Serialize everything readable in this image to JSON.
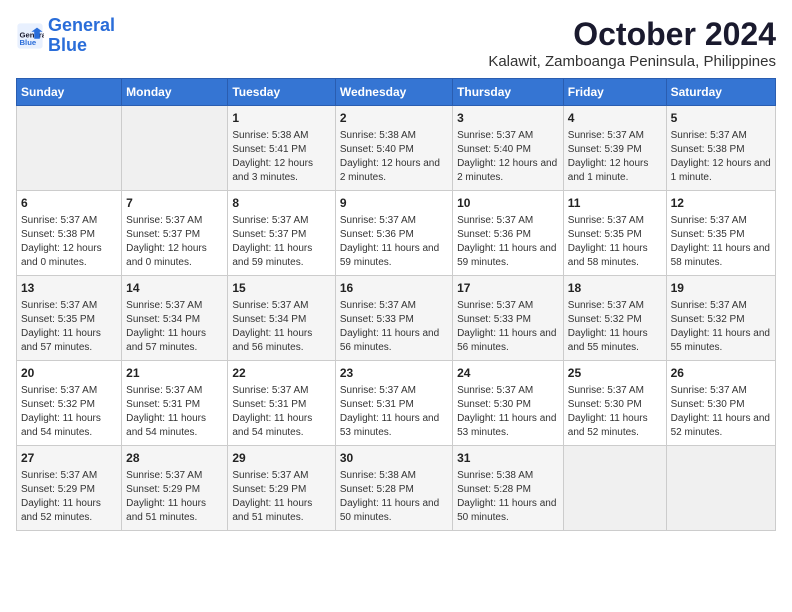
{
  "logo": {
    "text_general": "General",
    "text_blue": "Blue"
  },
  "title": "October 2024",
  "subtitle": "Kalawit, Zamboanga Peninsula, Philippines",
  "days_of_week": [
    "Sunday",
    "Monday",
    "Tuesday",
    "Wednesday",
    "Thursday",
    "Friday",
    "Saturday"
  ],
  "weeks": [
    [
      {
        "day": "",
        "info": ""
      },
      {
        "day": "",
        "info": ""
      },
      {
        "day": "1",
        "info": "Sunrise: 5:38 AM\nSunset: 5:41 PM\nDaylight: 12 hours and 3 minutes."
      },
      {
        "day": "2",
        "info": "Sunrise: 5:38 AM\nSunset: 5:40 PM\nDaylight: 12 hours and 2 minutes."
      },
      {
        "day": "3",
        "info": "Sunrise: 5:37 AM\nSunset: 5:40 PM\nDaylight: 12 hours and 2 minutes."
      },
      {
        "day": "4",
        "info": "Sunrise: 5:37 AM\nSunset: 5:39 PM\nDaylight: 12 hours and 1 minute."
      },
      {
        "day": "5",
        "info": "Sunrise: 5:37 AM\nSunset: 5:38 PM\nDaylight: 12 hours and 1 minute."
      }
    ],
    [
      {
        "day": "6",
        "info": "Sunrise: 5:37 AM\nSunset: 5:38 PM\nDaylight: 12 hours and 0 minutes."
      },
      {
        "day": "7",
        "info": "Sunrise: 5:37 AM\nSunset: 5:37 PM\nDaylight: 12 hours and 0 minutes."
      },
      {
        "day": "8",
        "info": "Sunrise: 5:37 AM\nSunset: 5:37 PM\nDaylight: 11 hours and 59 minutes."
      },
      {
        "day": "9",
        "info": "Sunrise: 5:37 AM\nSunset: 5:36 PM\nDaylight: 11 hours and 59 minutes."
      },
      {
        "day": "10",
        "info": "Sunrise: 5:37 AM\nSunset: 5:36 PM\nDaylight: 11 hours and 59 minutes."
      },
      {
        "day": "11",
        "info": "Sunrise: 5:37 AM\nSunset: 5:35 PM\nDaylight: 11 hours and 58 minutes."
      },
      {
        "day": "12",
        "info": "Sunrise: 5:37 AM\nSunset: 5:35 PM\nDaylight: 11 hours and 58 minutes."
      }
    ],
    [
      {
        "day": "13",
        "info": "Sunrise: 5:37 AM\nSunset: 5:35 PM\nDaylight: 11 hours and 57 minutes."
      },
      {
        "day": "14",
        "info": "Sunrise: 5:37 AM\nSunset: 5:34 PM\nDaylight: 11 hours and 57 minutes."
      },
      {
        "day": "15",
        "info": "Sunrise: 5:37 AM\nSunset: 5:34 PM\nDaylight: 11 hours and 56 minutes."
      },
      {
        "day": "16",
        "info": "Sunrise: 5:37 AM\nSunset: 5:33 PM\nDaylight: 11 hours and 56 minutes."
      },
      {
        "day": "17",
        "info": "Sunrise: 5:37 AM\nSunset: 5:33 PM\nDaylight: 11 hours and 56 minutes."
      },
      {
        "day": "18",
        "info": "Sunrise: 5:37 AM\nSunset: 5:32 PM\nDaylight: 11 hours and 55 minutes."
      },
      {
        "day": "19",
        "info": "Sunrise: 5:37 AM\nSunset: 5:32 PM\nDaylight: 11 hours and 55 minutes."
      }
    ],
    [
      {
        "day": "20",
        "info": "Sunrise: 5:37 AM\nSunset: 5:32 PM\nDaylight: 11 hours and 54 minutes."
      },
      {
        "day": "21",
        "info": "Sunrise: 5:37 AM\nSunset: 5:31 PM\nDaylight: 11 hours and 54 minutes."
      },
      {
        "day": "22",
        "info": "Sunrise: 5:37 AM\nSunset: 5:31 PM\nDaylight: 11 hours and 54 minutes."
      },
      {
        "day": "23",
        "info": "Sunrise: 5:37 AM\nSunset: 5:31 PM\nDaylight: 11 hours and 53 minutes."
      },
      {
        "day": "24",
        "info": "Sunrise: 5:37 AM\nSunset: 5:30 PM\nDaylight: 11 hours and 53 minutes."
      },
      {
        "day": "25",
        "info": "Sunrise: 5:37 AM\nSunset: 5:30 PM\nDaylight: 11 hours and 52 minutes."
      },
      {
        "day": "26",
        "info": "Sunrise: 5:37 AM\nSunset: 5:30 PM\nDaylight: 11 hours and 52 minutes."
      }
    ],
    [
      {
        "day": "27",
        "info": "Sunrise: 5:37 AM\nSunset: 5:29 PM\nDaylight: 11 hours and 52 minutes."
      },
      {
        "day": "28",
        "info": "Sunrise: 5:37 AM\nSunset: 5:29 PM\nDaylight: 11 hours and 51 minutes."
      },
      {
        "day": "29",
        "info": "Sunrise: 5:37 AM\nSunset: 5:29 PM\nDaylight: 11 hours and 51 minutes."
      },
      {
        "day": "30",
        "info": "Sunrise: 5:38 AM\nSunset: 5:28 PM\nDaylight: 11 hours and 50 minutes."
      },
      {
        "day": "31",
        "info": "Sunrise: 5:38 AM\nSunset: 5:28 PM\nDaylight: 11 hours and 50 minutes."
      },
      {
        "day": "",
        "info": ""
      },
      {
        "day": "",
        "info": ""
      }
    ]
  ]
}
